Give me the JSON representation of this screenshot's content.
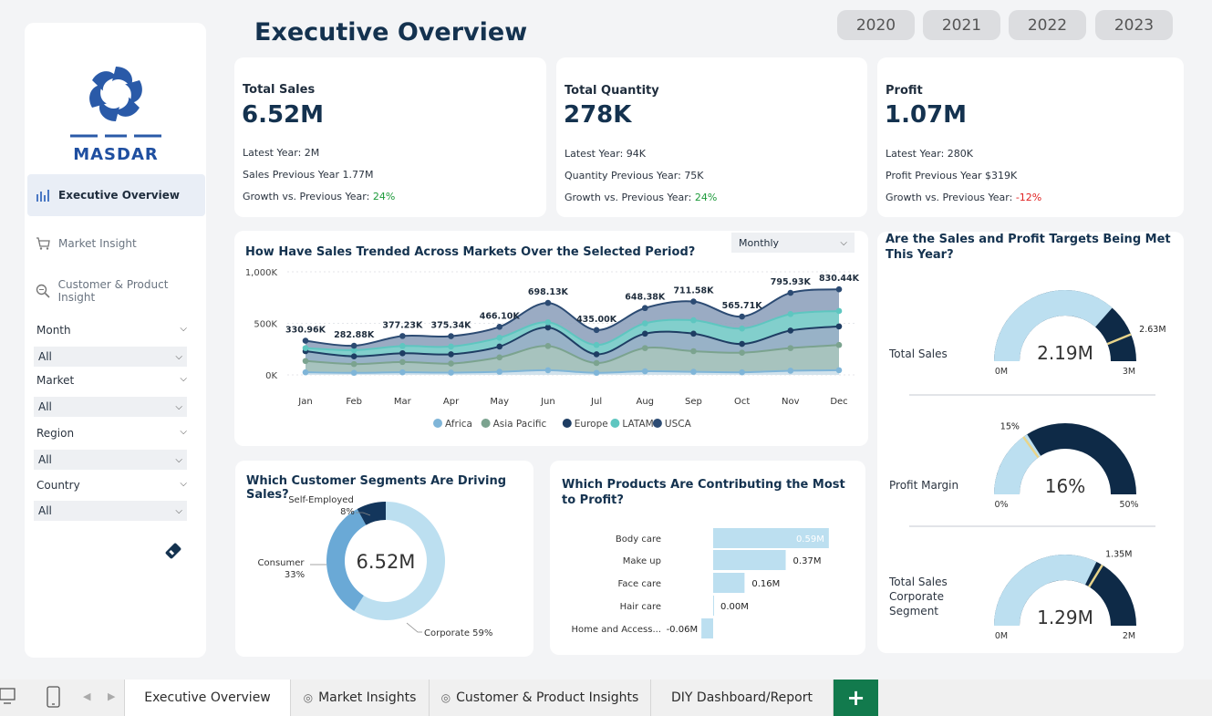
{
  "title": "Executive Overview",
  "years": [
    "2020",
    "2021",
    "2022",
    "2023"
  ],
  "sidebar": {
    "brand": "MASDAR",
    "nav": [
      {
        "label": "Executive Overview",
        "icon": "bar-chart-icon"
      },
      {
        "label": "Market Insight",
        "icon": "cart-icon"
      },
      {
        "label": "Customer & Product Insight",
        "icon": "magnifier-icon"
      }
    ],
    "filters": [
      {
        "label": "Month",
        "value": "All"
      },
      {
        "label": "Market",
        "value": "All"
      },
      {
        "label": "Region",
        "value": "All"
      },
      {
        "label": "Country",
        "value": "All"
      }
    ],
    "eraser_icon": "eraser-icon"
  },
  "kpis": [
    {
      "label": "Total Sales",
      "value": "6.52M",
      "latest": "Latest Year: 2M",
      "previous": "Sales Previous Year 1.77M",
      "growth_label": "Growth vs. Previous Year: ",
      "growth": "24%",
      "growth_sign": "pos"
    },
    {
      "label": "Total Quantity",
      "value": "278K",
      "latest": "Latest Year: 94K",
      "previous": "Quantity Previous Year: 75K",
      "growth_label": "Growth vs. Previous Year: ",
      "growth": "24%",
      "growth_sign": "pos"
    },
    {
      "label": "Profit",
      "value": "1.07M",
      "latest": "Latest Year: 280K",
      "previous": "Profit Previous Year $319K",
      "growth_label": "Growth vs. Previous Year: ",
      "growth": "-12%",
      "growth_sign": "neg"
    }
  ],
  "trend": {
    "title": "How Have Sales Trended Across Markets Over the Selected Period?",
    "dropdown": "Monthly"
  },
  "segments": {
    "title": "Which Customer Segments Are Driving Sales?"
  },
  "products": {
    "title": "Which Products Are Contributing the Most to Profit?"
  },
  "targets": {
    "title": "Are the Sales and Profit Targets Being Met This Year?"
  },
  "chart_data": [
    {
      "type": "area",
      "categories": [
        "Jan",
        "Feb",
        "Mar",
        "Apr",
        "May",
        "Jun",
        "Jul",
        "Aug",
        "Sep",
        "Oct",
        "Nov",
        "Dec"
      ],
      "ylim": [
        0,
        1000000
      ],
      "yticks": [
        {
          "v": 0,
          "label": "0K"
        },
        {
          "v": 500000,
          "label": "500K"
        },
        {
          "v": 1000000,
          "label": "1,000K"
        }
      ],
      "series": [
        {
          "name": "Africa",
          "color": "#7fb5d8",
          "values": [
            25000,
            20000,
            25000,
            22000,
            30000,
            45000,
            20000,
            35000,
            30000,
            25000,
            40000,
            45000
          ]
        },
        {
          "name": "Asia Pacific",
          "color": "#7ba38f",
          "values": [
            135000,
            105000,
            125000,
            110000,
            170000,
            280000,
            115000,
            260000,
            230000,
            215000,
            260000,
            290000
          ]
        },
        {
          "name": "Europe",
          "color": "#1e3d63",
          "values": [
            230000,
            180000,
            210000,
            200000,
            275000,
            460000,
            200000,
            400000,
            400000,
            300000,
            430000,
            470000
          ]
        },
        {
          "name": "LATAM",
          "color": "#5ec6c0",
          "values": [
            260000,
            240000,
            280000,
            275000,
            360000,
            510000,
            290000,
            500000,
            530000,
            450000,
            590000,
            620000
          ]
        },
        {
          "name": "USCA",
          "color": "#2c4b73",
          "values": [
            330960,
            282880,
            377230,
            375340,
            466100,
            698130,
            435000,
            648380,
            711580,
            565710,
            795930,
            830440
          ]
        }
      ],
      "total_labels": [
        "330.96K",
        "282.88K",
        "377.23K",
        "375.34K",
        "466.10K",
        "698.13K",
        "435.00K",
        "648.38K",
        "711.58K",
        "565.71K",
        "795.93K",
        "830.44K"
      ]
    },
    {
      "type": "pie",
      "center_label": "6.52M",
      "slices": [
        {
          "name": "Corporate",
          "value": 59,
          "label": "Corporate 59%",
          "color": "#bcdff0"
        },
        {
          "name": "Consumer",
          "value": 33,
          "label": "Consumer 33%",
          "color": "#6aa9d6"
        },
        {
          "name": "Self-Employed",
          "value": 8,
          "label": "Self-Employed 8%",
          "color": "#13365c"
        }
      ]
    },
    {
      "type": "bar",
      "categories": [
        "Body care",
        "Make up",
        "Face care",
        "Hair care",
        "Home and Access..."
      ],
      "values": [
        0.59,
        0.37,
        0.16,
        0.0,
        -0.06
      ],
      "labels": [
        "0.59M",
        "0.37M",
        "0.16M",
        "0.00M",
        "-0.06M"
      ],
      "color": "#bcdff0"
    },
    {
      "type": "gauge",
      "gauges": [
        {
          "label": "Total Sales",
          "value": 2.19,
          "target": 2.63,
          "min": 0,
          "max": 3,
          "value_label": "2.19M",
          "target_label": "2.63M",
          "min_label": "0M",
          "max_label": "3M"
        },
        {
          "label": "Profit Margin",
          "value": 16,
          "target": 15,
          "min": 0,
          "max": 50,
          "value_label": "16%",
          "target_label": "15%",
          "min_label": "0%",
          "max_label": "50%"
        },
        {
          "label": "Total Sales\nCorporate\nSegment",
          "value": 1.29,
          "target": 1.35,
          "min": 0,
          "max": 2,
          "value_label": "1.29M",
          "target_label": "1.35M",
          "min_label": "0M",
          "max_label": "2M"
        }
      ]
    }
  ],
  "tabs": [
    {
      "label": "Executive Overview",
      "active": true,
      "hidden": false
    },
    {
      "label": "Market Insights",
      "active": false,
      "hidden": true
    },
    {
      "label": "Customer & Product Insights",
      "active": false,
      "hidden": true
    },
    {
      "label": "DIY Dashboard/Report",
      "active": false,
      "hidden": false
    }
  ],
  "add_tab": "+"
}
